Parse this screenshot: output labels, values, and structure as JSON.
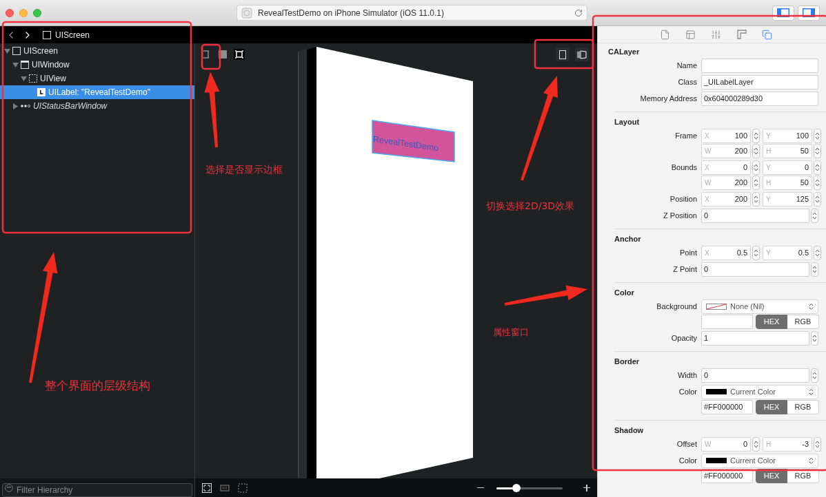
{
  "window": {
    "title": "RevealTestDemo on iPhone Simulator (iOS 11.0.1)"
  },
  "panel_toggles": [
    {
      "kind": "left",
      "selected": true
    },
    {
      "kind": "right",
      "selected": true
    }
  ],
  "breadcrumb": {
    "label": "UIScreen"
  },
  "tree": [
    {
      "label": "UIScreen",
      "kind": "screen",
      "expanded": true,
      "selected": false,
      "hidden": false,
      "children": [
        {
          "label": "UIWindow",
          "kind": "window",
          "expanded": true,
          "selected": false,
          "hidden": false,
          "children": [
            {
              "label": "UIView",
              "kind": "view",
              "expanded": true,
              "selected": false,
              "hidden": false,
              "children": [
                {
                  "label": "UILabel: \"RevealTestDemo\"",
                  "kind": "label",
                  "selected": true,
                  "hidden": false
                }
              ]
            }
          ]
        },
        {
          "label": "UIStatusBarWindow",
          "kind": "dots",
          "expanded": false,
          "selected": false,
          "hidden": true
        }
      ]
    }
  ],
  "filter": {
    "placeholder": "Filter Hierarchy"
  },
  "preview": {
    "label_text": "RevealTestDemo"
  },
  "zoom": {
    "level": 0.3
  },
  "inspector": {
    "tabs": [
      {
        "kind": "file",
        "selected": false
      },
      {
        "kind": "layout",
        "selected": false
      },
      {
        "kind": "sliders",
        "selected": false
      },
      {
        "kind": "ruler",
        "selected": false
      },
      {
        "kind": "layers",
        "selected": true
      }
    ],
    "sections": [
      {
        "title": "CALayer",
        "rows": [
          {
            "kind": "text",
            "label": "Name"
          },
          {
            "kind": "text",
            "label": "Class",
            "value": "_UILabelLayer"
          },
          {
            "kind": "text",
            "label": "Memory Address",
            "value": "0x604000289d30"
          }
        ]
      },
      {
        "title": "Layout",
        "rows": [
          {
            "kind": "pair",
            "label": "Frame",
            "fields": [
              {
                "axis": "X",
                "value": "100"
              },
              {
                "axis": "Y",
                "value": "100"
              }
            ]
          },
          {
            "kind": "pair",
            "fields": [
              {
                "axis": "W",
                "value": "200"
              },
              {
                "axis": "H",
                "value": "50"
              }
            ]
          },
          {
            "kind": "pair",
            "label": "Bounds",
            "fields": [
              {
                "axis": "X",
                "value": "0"
              },
              {
                "axis": "Y",
                "value": "0"
              }
            ]
          },
          {
            "kind": "pair",
            "fields": [
              {
                "axis": "W",
                "value": "200"
              },
              {
                "axis": "H",
                "value": "50"
              }
            ]
          },
          {
            "kind": "pair",
            "label": "Position",
            "fields": [
              {
                "axis": "X",
                "value": "200"
              },
              {
                "axis": "Y",
                "value": "125"
              }
            ]
          },
          {
            "kind": "stepper",
            "label": "Z Position",
            "value": "0"
          }
        ]
      },
      {
        "title": "Anchor",
        "rows": [
          {
            "kind": "pair",
            "label": "Point",
            "fields": [
              {
                "axis": "X",
                "value": "0.5"
              },
              {
                "axis": "Y",
                "value": "0.5"
              }
            ]
          },
          {
            "kind": "stepper",
            "label": "Z Point",
            "value": "0"
          }
        ]
      },
      {
        "title": "Color",
        "rows": [
          {
            "kind": "popup",
            "label": "Background",
            "value": "None (Nil)"
          },
          {
            "kind": "hex",
            "modes": [
              {
                "label": "HEX",
                "selected": true
              },
              {
                "label": "RGB",
                "selected": false
              }
            ]
          },
          {
            "kind": "stepper",
            "label": "Opacity",
            "value": "1"
          }
        ]
      },
      {
        "title": "Border",
        "rows": [
          {
            "kind": "stepper",
            "label": "Width",
            "value": "0"
          },
          {
            "kind": "popup",
            "label": "Color",
            "value": "Current Color",
            "color": "#000000"
          },
          {
            "kind": "hex",
            "value": "#FF000000",
            "modes": [
              {
                "label": "HEX",
                "selected": true
              },
              {
                "label": "RGB",
                "selected": false
              }
            ]
          }
        ]
      },
      {
        "title": "Shadow",
        "rows": [
          {
            "kind": "pair",
            "label": "Offset",
            "fields": [
              {
                "axis": "W",
                "value": "0"
              },
              {
                "axis": "H",
                "value": "-3"
              }
            ]
          },
          {
            "kind": "popup",
            "label": "Color",
            "value": "Current Color",
            "color": "#000000"
          },
          {
            "kind": "hex",
            "value": "#FF000000",
            "modes": [
              {
                "label": "HEX",
                "selected": true
              },
              {
                "label": "RGB",
                "selected": false
              }
            ]
          }
        ]
      }
    ]
  },
  "annotations": [
    {
      "text": "选择是否显示边框"
    },
    {
      "text": "切换选择2D/3D效果"
    },
    {
      "text": "属性窗口"
    },
    {
      "text": "整个界面的层级结构"
    }
  ]
}
